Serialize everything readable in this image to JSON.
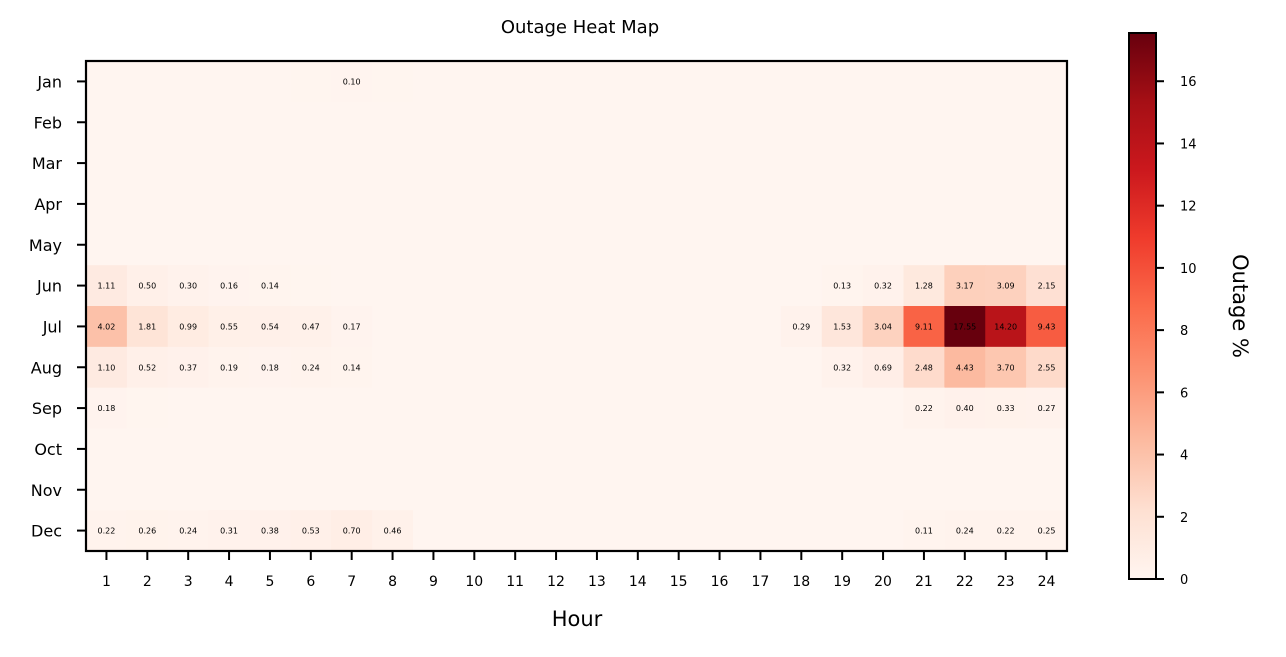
{
  "chart_data": {
    "type": "heatmap",
    "title": "Outage Heat Map",
    "xlabel": "Hour",
    "ylabel": "",
    "colorbar_label": "Outage %",
    "colormap": "Reds",
    "color_range": [
      0,
      17.55
    ],
    "colorbar_ticks": [
      0,
      2,
      4,
      6,
      8,
      10,
      12,
      14,
      16
    ],
    "x_categories": [
      "1",
      "2",
      "3",
      "4",
      "5",
      "6",
      "7",
      "8",
      "9",
      "10",
      "11",
      "12",
      "13",
      "14",
      "15",
      "16",
      "17",
      "18",
      "19",
      "20",
      "21",
      "22",
      "23",
      "24"
    ],
    "y_categories": [
      "Jan",
      "Feb",
      "Mar",
      "Apr",
      "May",
      "Jun",
      "Jul",
      "Aug",
      "Sep",
      "Oct",
      "Nov",
      "Dec"
    ],
    "label_threshold": 0.1,
    "values": [
      [
        0,
        0,
        0,
        0,
        0,
        0.05,
        0.1,
        0.05,
        0,
        0,
        0,
        0,
        0,
        0,
        0,
        0,
        0,
        0,
        0,
        0,
        0,
        0,
        0,
        0
      ],
      [
        0,
        0,
        0,
        0,
        0,
        0,
        0,
        0,
        0,
        0,
        0,
        0,
        0,
        0,
        0,
        0,
        0,
        0,
        0,
        0,
        0,
        0,
        0,
        0
      ],
      [
        0,
        0,
        0,
        0,
        0,
        0,
        0,
        0,
        0,
        0,
        0,
        0,
        0,
        0,
        0,
        0,
        0,
        0,
        0,
        0,
        0,
        0,
        0,
        0
      ],
      [
        0,
        0,
        0,
        0,
        0,
        0,
        0,
        0,
        0,
        0,
        0,
        0,
        0,
        0,
        0,
        0,
        0,
        0,
        0,
        0,
        0,
        0,
        0,
        0
      ],
      [
        0,
        0,
        0,
        0,
        0,
        0,
        0,
        0,
        0,
        0,
        0,
        0,
        0,
        0,
        0,
        0,
        0,
        0,
        0,
        0,
        0,
        0,
        0,
        0
      ],
      [
        1.11,
        0.5,
        0.3,
        0.16,
        0.14,
        0.05,
        0,
        0,
        0,
        0,
        0,
        0,
        0,
        0,
        0,
        0,
        0,
        0,
        0.13,
        0.32,
        1.28,
        3.17,
        3.09,
        2.15
      ],
      [
        4.02,
        1.81,
        0.99,
        0.55,
        0.54,
        0.47,
        0.17,
        0,
        0,
        0,
        0,
        0,
        0,
        0,
        0,
        0,
        0,
        0.29,
        1.53,
        3.04,
        9.11,
        17.55,
        14.2,
        9.43
      ],
      [
        1.1,
        0.52,
        0.37,
        0.19,
        0.18,
        0.24,
        0.14,
        0,
        0,
        0,
        0,
        0,
        0,
        0,
        0,
        0,
        0,
        0,
        0.32,
        0.69,
        2.48,
        4.43,
        3.7,
        2.55
      ],
      [
        0.18,
        0.05,
        0,
        0,
        0,
        0,
        0,
        0,
        0,
        0,
        0,
        0,
        0,
        0,
        0,
        0,
        0,
        0,
        0,
        0,
        0.22,
        0.4,
        0.33,
        0.27
      ],
      [
        0,
        0,
        0,
        0,
        0,
        0,
        0,
        0,
        0,
        0,
        0,
        0,
        0,
        0,
        0,
        0,
        0,
        0,
        0,
        0,
        0,
        0,
        0,
        0
      ],
      [
        0,
        0,
        0,
        0,
        0,
        0,
        0,
        0,
        0,
        0,
        0,
        0,
        0,
        0,
        0,
        0,
        0,
        0,
        0,
        0,
        0,
        0,
        0,
        0
      ],
      [
        0.22,
        0.26,
        0.24,
        0.31,
        0.38,
        0.53,
        0.7,
        0.46,
        0,
        0,
        0,
        0,
        0,
        0,
        0,
        0,
        0,
        0,
        0,
        0,
        0.11,
        0.24,
        0.22,
        0.25
      ]
    ]
  }
}
